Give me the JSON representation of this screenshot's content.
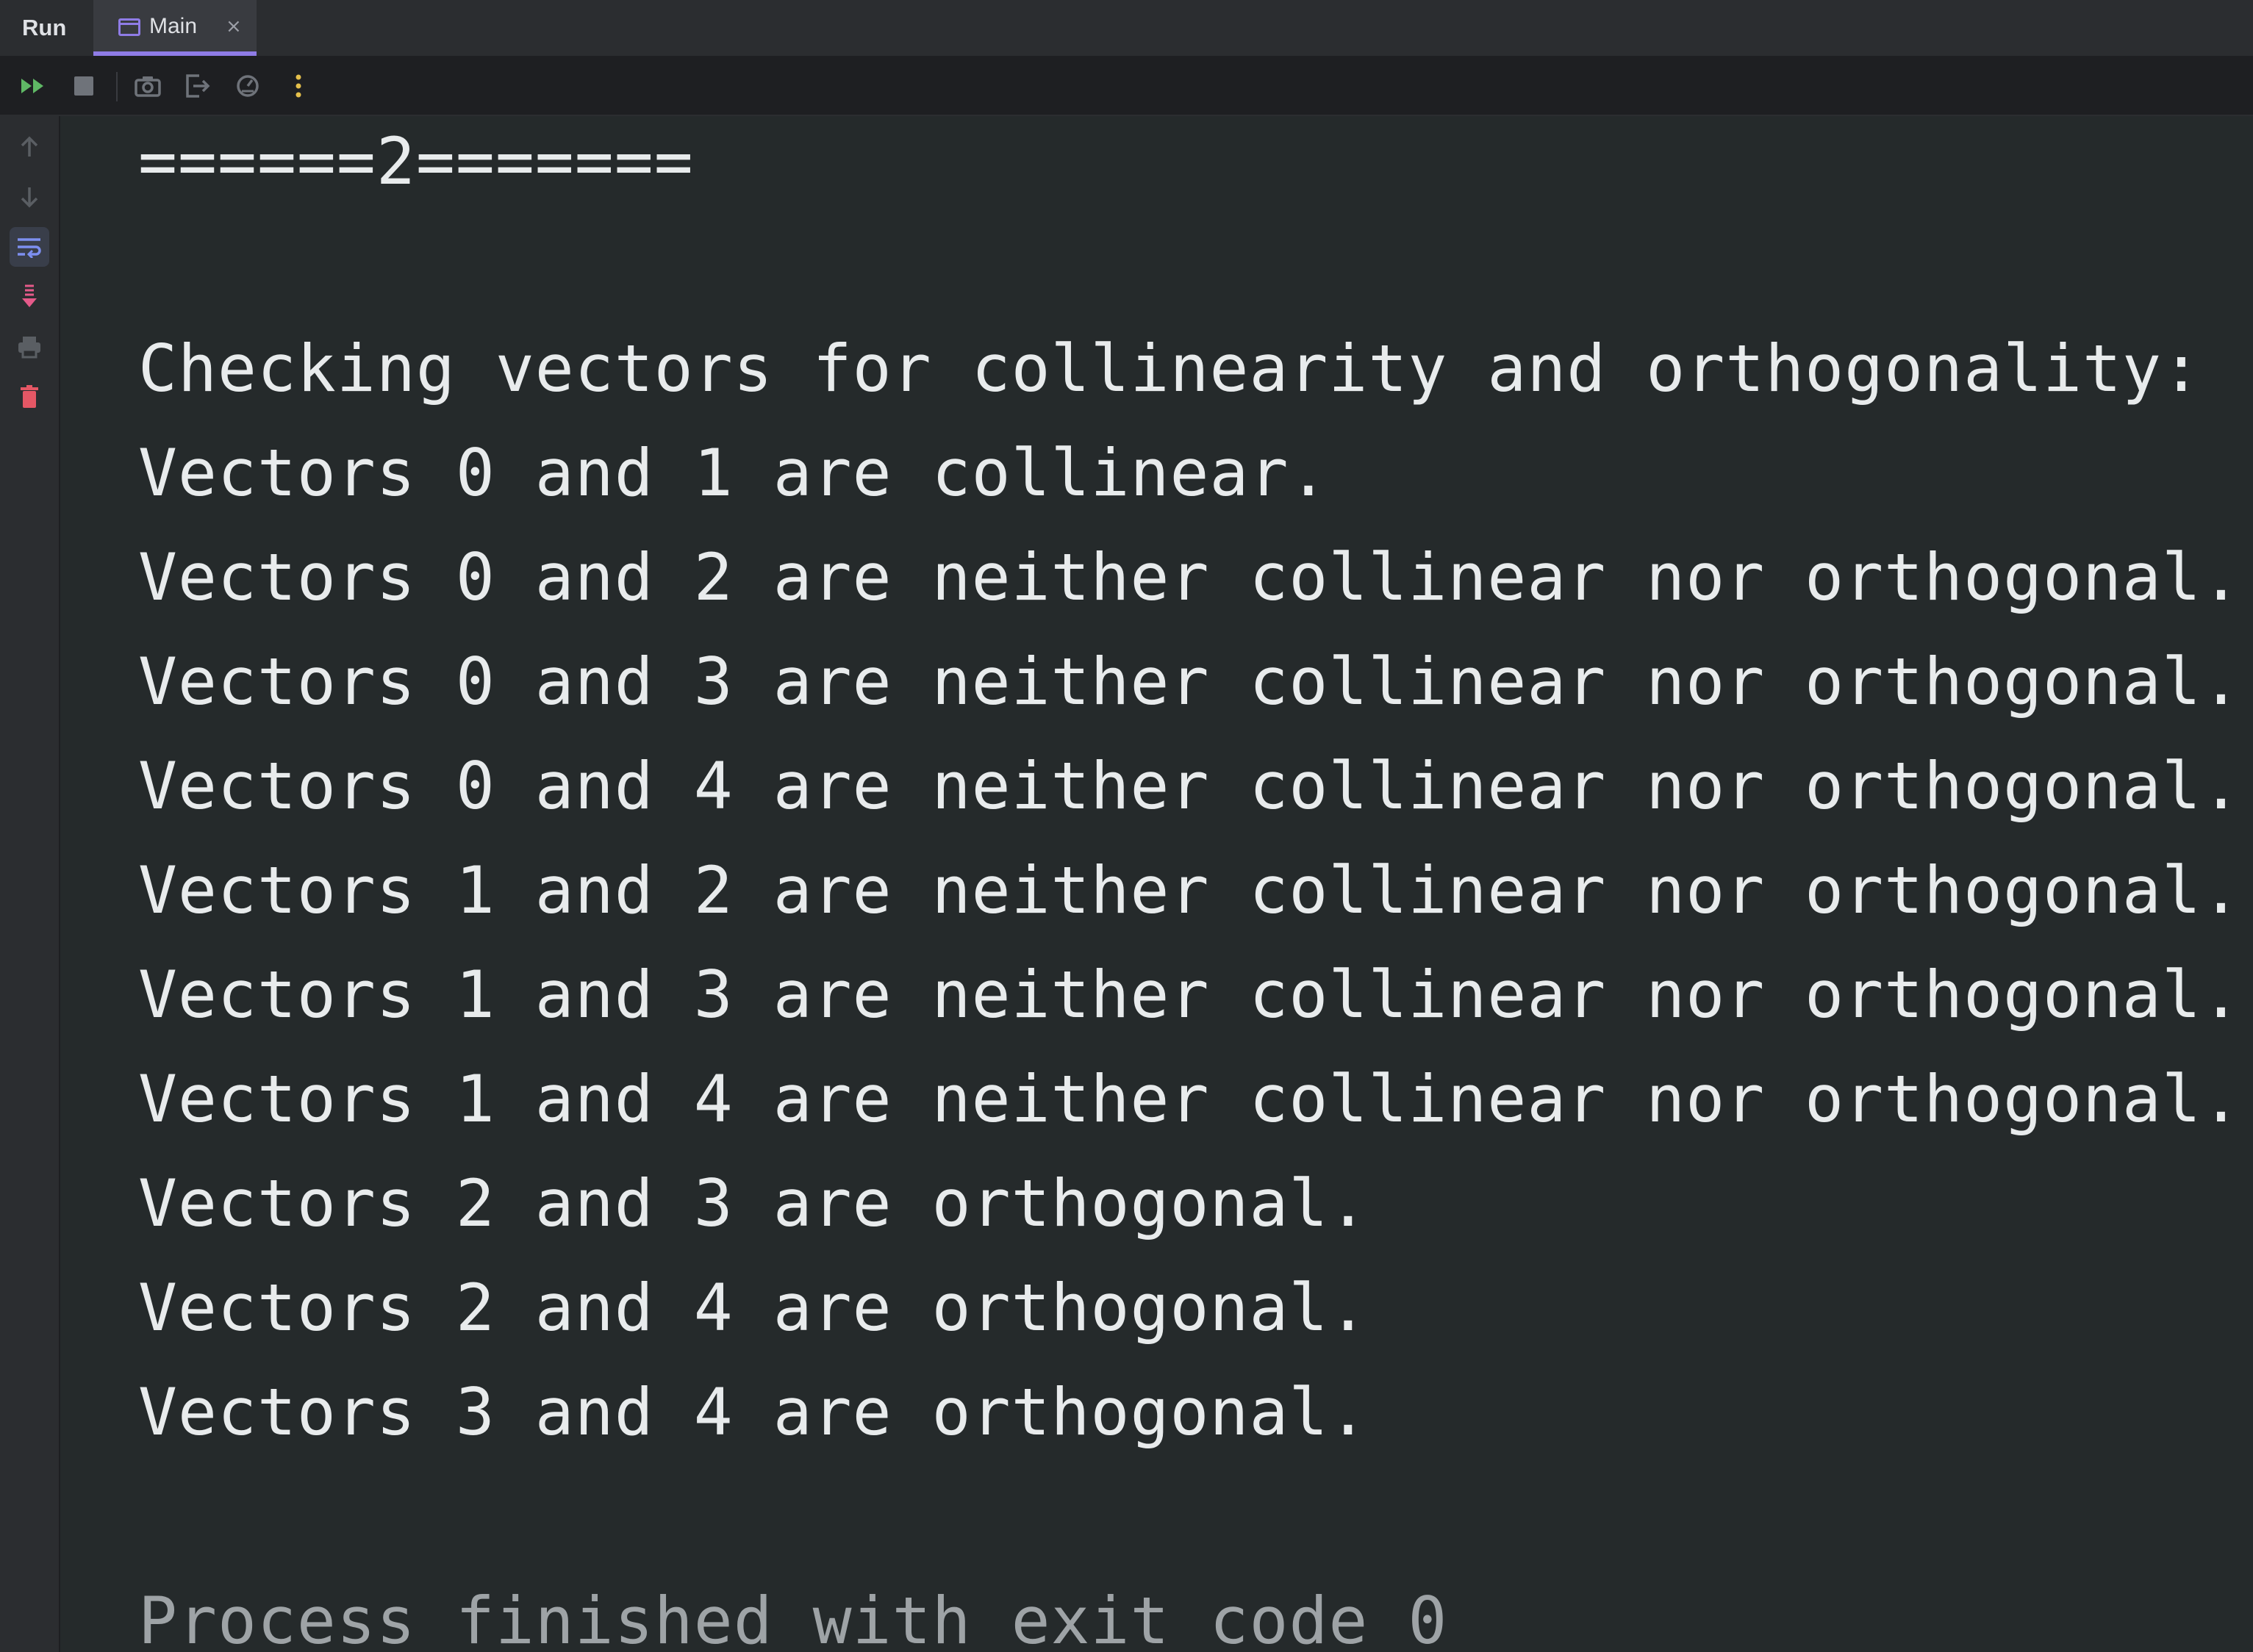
{
  "tool_window": {
    "title": "Run",
    "tabs": [
      {
        "label": "Main",
        "close_glyph": "×",
        "icon": "console-window-icon"
      }
    ]
  },
  "toolbar": {
    "buttons": [
      {
        "name": "rerun-button",
        "icon": "double-play-icon",
        "color": "#5fb865"
      },
      {
        "name": "stop-button",
        "icon": "stop-square-icon",
        "color": "#6f737a"
      },
      {
        "name": "screenshot-button",
        "icon": "camera-icon",
        "color": "#6f737a"
      },
      {
        "name": "exit-button",
        "icon": "exit-door-icon",
        "color": "#6f737a"
      },
      {
        "name": "profiler-button",
        "icon": "gauge-icon",
        "color": "#6f737a"
      },
      {
        "name": "more-button",
        "icon": "kebab-menu-icon",
        "color": "#e5c04b"
      }
    ]
  },
  "gutter": {
    "buttons": [
      {
        "name": "scroll-up-button",
        "icon": "arrow-up-icon"
      },
      {
        "name": "scroll-down-button",
        "icon": "arrow-down-icon"
      },
      {
        "name": "soft-wrap-button",
        "icon": "soft-wrap-icon",
        "active": true
      },
      {
        "name": "scroll-to-end-button",
        "icon": "scroll-to-end-icon"
      },
      {
        "name": "print-button",
        "icon": "printer-icon"
      },
      {
        "name": "clear-all-button",
        "icon": "trash-icon"
      }
    ]
  },
  "console": {
    "lines": [
      "======2=======",
      "",
      "Checking vectors for collinearity and orthogonality:",
      "Vectors 0 and 1 are collinear.",
      "Vectors 0 and 2 are neither collinear nor orthogonal.",
      "Vectors 0 and 3 are neither collinear nor orthogonal.",
      "Vectors 0 and 4 are neither collinear nor orthogonal.",
      "Vectors 1 and 2 are neither collinear nor orthogonal.",
      "Vectors 1 and 3 are neither collinear nor orthogonal.",
      "Vectors 1 and 4 are neither collinear nor orthogonal.",
      "Vectors 2 and 3 are orthogonal.",
      "Vectors 2 and 4 are orthogonal.",
      "Vectors 3 and 4 are orthogonal.",
      "",
      "Process finished with exit code 0"
    ]
  },
  "colors": {
    "background": "#252a2b",
    "text": "#e8ebec",
    "text_dim": "#9ea3a6",
    "accent": "#8f7ce6",
    "run_green": "#5fb865",
    "clear_red": "#e55765",
    "scroll_end_pink": "#e55a8a"
  }
}
